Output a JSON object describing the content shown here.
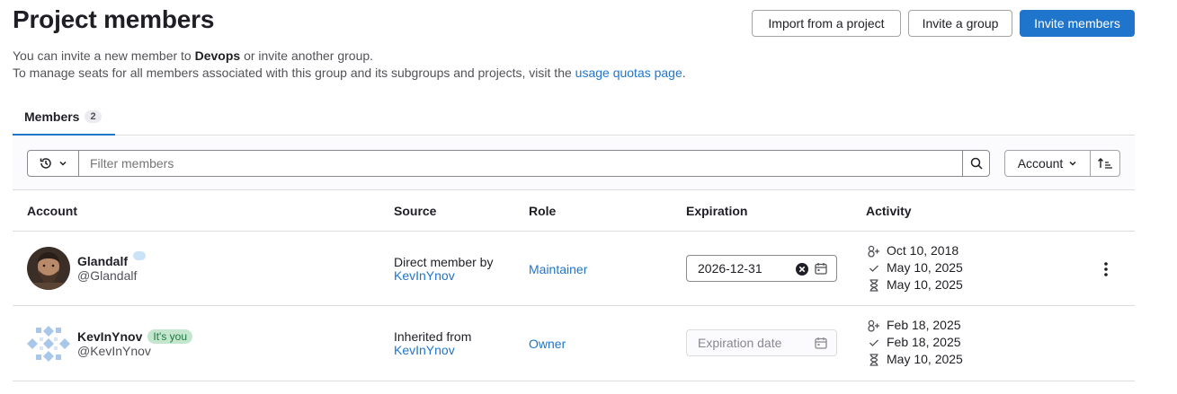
{
  "page": {
    "title": "Project members",
    "desc_line1_pre": "You can invite a new member to ",
    "desc_line1_bold": "Devops",
    "desc_line1_post": " or invite another group.",
    "desc_line2_pre": "To manage seats for all members associated with this group and its subgroups and projects, visit the ",
    "desc_line2_link": "usage quotas page",
    "desc_line2_post": "."
  },
  "header_buttons": {
    "import": "Import from a project",
    "invite_group": "Invite a group",
    "invite_members": "Invite members"
  },
  "tabs": [
    {
      "label": "Members",
      "count": "2"
    }
  ],
  "filter": {
    "placeholder": "Filter members",
    "sort_label": "Account"
  },
  "columns": {
    "account": "Account",
    "source": "Source",
    "role": "Role",
    "expiration": "Expiration",
    "activity": "Activity"
  },
  "members": [
    {
      "name": "Glandalf",
      "handle": "@Glandalf",
      "badge": "",
      "source_text": "Direct member by",
      "source_link": "KevInYnov",
      "role": "Maintainer",
      "expiration": "2026-12-31",
      "activity": [
        "Oct 10, 2018",
        "May 10, 2025",
        "May 10, 2025"
      ]
    },
    {
      "name": "KevInYnov",
      "handle": "@KevInYnov",
      "badge": "It's you",
      "source_text": "Inherited from",
      "source_link": "KevInYnov",
      "role": "Owner",
      "expiration_placeholder": "Expiration date",
      "activity": [
        "Feb 18, 2025",
        "Feb 18, 2025",
        "May 10, 2025"
      ]
    }
  ],
  "colors": {
    "primary": "#1f75cb",
    "badge_green_bg": "#c3e6cd",
    "badge_green_text": "#217645"
  }
}
